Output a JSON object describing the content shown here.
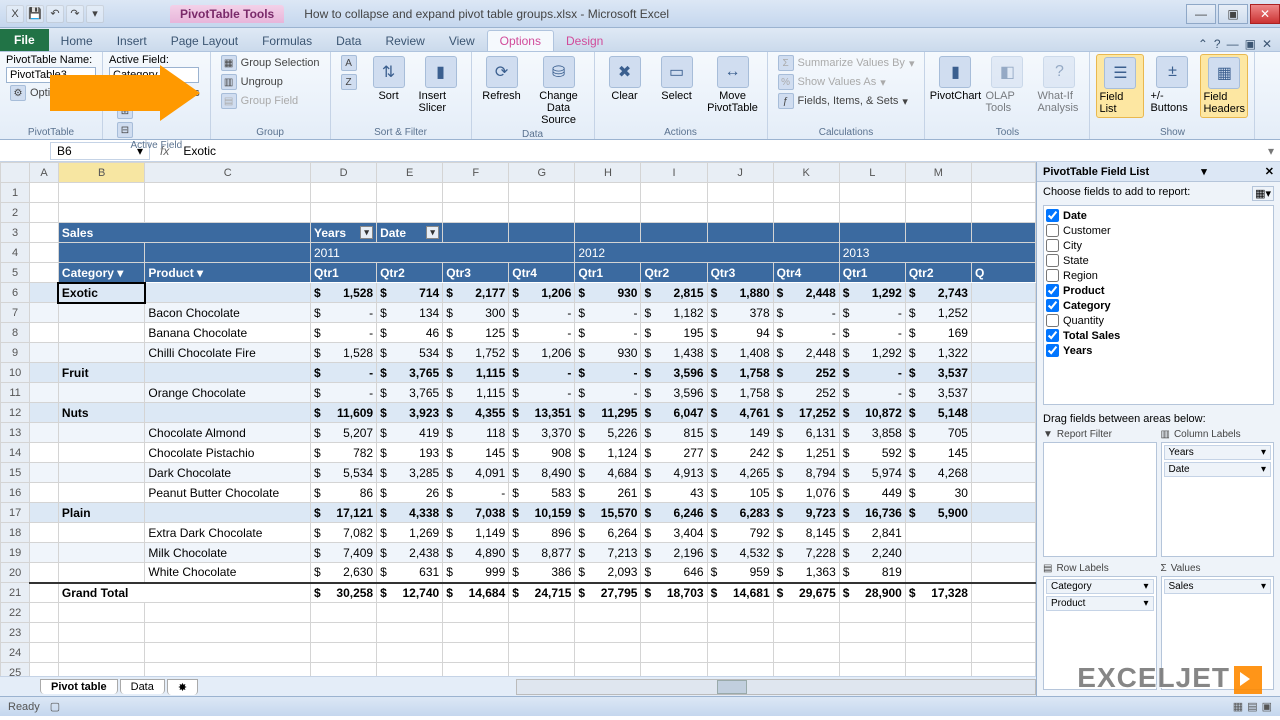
{
  "title": {
    "context_tab": "PivotTable Tools",
    "document": "How to collapse and expand pivot table groups.xlsx - Microsoft Excel"
  },
  "qat": [
    "excel-icon",
    "save",
    "undo",
    "redo"
  ],
  "tabs": [
    "File",
    "Home",
    "Insert",
    "Page Layout",
    "Formulas",
    "Data",
    "Review",
    "View",
    "Options",
    "Design"
  ],
  "active_tab": "Options",
  "ribbon": {
    "pt_name_label": "PivotTable Name:",
    "pt_name_value": "PivotTable3",
    "options_btn": "Options",
    "group1": "PivotTable",
    "active_field_label": "Active Field:",
    "active_field_value": "Category",
    "field_settings": "Field Settings",
    "group2": "Active Field",
    "group_selection": "Group Selection",
    "ungroup": "Ungroup",
    "group_field": "Group Field",
    "group3": "Group",
    "sort_az": "A→Z",
    "sort_za": "Z→A",
    "sort": "Sort",
    "insert_slicer": "Insert Slicer",
    "group4": "Sort & Filter",
    "refresh": "Refresh",
    "change_source": "Change Data Source",
    "group5": "Data",
    "clear": "Clear",
    "select": "Select",
    "move": "Move PivotTable",
    "group6": "Actions",
    "summarize": "Summarize Values By",
    "show_as": "Show Values As",
    "fields_items": "Fields, Items, & Sets",
    "group7": "Calculations",
    "pivotchart": "PivotChart",
    "olap": "OLAP Tools",
    "whatif": "What-If Analysis",
    "group8": "Tools",
    "field_list": "Field List",
    "pm_buttons": "+/- Buttons",
    "field_headers": "Field Headers",
    "group9": "Show"
  },
  "namebox": "B6",
  "fx_value": "Exotic",
  "col_letters": [
    "A",
    "B",
    "C",
    "D",
    "E",
    "F",
    "G",
    "H",
    "I",
    "J",
    "K",
    "L",
    "M"
  ],
  "pivot": {
    "title": "Sales",
    "years_label": "Years",
    "date_label": "Date",
    "years": [
      "2011",
      "2012",
      "2013"
    ],
    "category_label": "Category",
    "product_label": "Product",
    "quarters": [
      "Qtr1",
      "Qtr2",
      "Qtr3",
      "Qtr4",
      "Qtr1",
      "Qtr2",
      "Qtr3",
      "Qtr4",
      "Qtr1",
      "Qtr2",
      "Q"
    ],
    "rows": [
      {
        "type": "cat",
        "cat": "Exotic",
        "prod": "",
        "vals": [
          "1,528",
          "714",
          "2,177",
          "1,206",
          "930",
          "2,815",
          "1,880",
          "2,448",
          "1,292",
          "2,743"
        ]
      },
      {
        "type": "item",
        "prod": "Bacon Chocolate",
        "vals": [
          "-",
          "134",
          "300",
          "-",
          "-",
          "1,182",
          "378",
          "-",
          "-",
          "1,252"
        ]
      },
      {
        "type": "item",
        "prod": "Banana Chocolate",
        "vals": [
          "-",
          "46",
          "125",
          "-",
          "-",
          "195",
          "94",
          "-",
          "-",
          "169"
        ]
      },
      {
        "type": "item",
        "prod": "Chilli Chocolate Fire",
        "vals": [
          "1,528",
          "534",
          "1,752",
          "1,206",
          "930",
          "1,438",
          "1,408",
          "2,448",
          "1,292",
          "1,322"
        ]
      },
      {
        "type": "cat",
        "cat": "Fruit",
        "prod": "",
        "vals": [
          "-",
          "3,765",
          "1,115",
          "-",
          "-",
          "3,596",
          "1,758",
          "252",
          "-",
          "3,537"
        ]
      },
      {
        "type": "item",
        "prod": "Orange Chocolate",
        "vals": [
          "-",
          "3,765",
          "1,115",
          "-",
          "-",
          "3,596",
          "1,758",
          "252",
          "-",
          "3,537"
        ]
      },
      {
        "type": "cat",
        "cat": "Nuts",
        "prod": "",
        "vals": [
          "11,609",
          "3,923",
          "4,355",
          "13,351",
          "11,295",
          "6,047",
          "4,761",
          "17,252",
          "10,872",
          "5,148"
        ]
      },
      {
        "type": "item",
        "prod": "Chocolate Almond",
        "vals": [
          "5,207",
          "419",
          "118",
          "3,370",
          "5,226",
          "815",
          "149",
          "6,131",
          "3,858",
          "705"
        ]
      },
      {
        "type": "item",
        "prod": "Chocolate Pistachio",
        "vals": [
          "782",
          "193",
          "145",
          "908",
          "1,124",
          "277",
          "242",
          "1,251",
          "592",
          "145"
        ]
      },
      {
        "type": "item",
        "prod": "Dark Chocolate",
        "vals": [
          "5,534",
          "3,285",
          "4,091",
          "8,490",
          "4,684",
          "4,913",
          "4,265",
          "8,794",
          "5,974",
          "4,268"
        ]
      },
      {
        "type": "item",
        "prod": "Peanut Butter Chocolate",
        "vals": [
          "86",
          "26",
          "-",
          "583",
          "261",
          "43",
          "105",
          "1,076",
          "449",
          "30"
        ]
      },
      {
        "type": "cat",
        "cat": "Plain",
        "prod": "",
        "vals": [
          "17,121",
          "4,338",
          "7,038",
          "10,159",
          "15,570",
          "6,246",
          "6,283",
          "9,723",
          "16,736",
          "5,900"
        ]
      },
      {
        "type": "item",
        "prod": "Extra Dark Chocolate",
        "vals": [
          "7,082",
          "1,269",
          "1,149",
          "896",
          "6,264",
          "3,404",
          "792",
          "8,145",
          "2,841",
          ""
        ]
      },
      {
        "type": "item",
        "prod": "Milk Chocolate",
        "vals": [
          "7,409",
          "2,438",
          "4,890",
          "8,877",
          "7,213",
          "2,196",
          "4,532",
          "7,228",
          "2,240",
          ""
        ]
      },
      {
        "type": "item",
        "prod": "White Chocolate",
        "vals": [
          "2,630",
          "631",
          "999",
          "386",
          "2,093",
          "646",
          "959",
          "1,363",
          "819",
          ""
        ]
      },
      {
        "type": "gt",
        "cat": "Grand Total",
        "vals": [
          "30,258",
          "12,740",
          "14,684",
          "24,715",
          "27,795",
          "18,703",
          "14,681",
          "29,675",
          "28,900",
          "17,328"
        ]
      }
    ]
  },
  "sheet_tabs": [
    "Pivot table",
    "Data"
  ],
  "active_sheet": "Pivot table",
  "status": "Ready",
  "field_pane": {
    "title": "PivotTable Field List",
    "choose": "Choose fields to add to report:",
    "fields": [
      {
        "name": "Date",
        "checked": true
      },
      {
        "name": "Customer",
        "checked": false
      },
      {
        "name": "City",
        "checked": false
      },
      {
        "name": "State",
        "checked": false
      },
      {
        "name": "Region",
        "checked": false
      },
      {
        "name": "Product",
        "checked": true
      },
      {
        "name": "Category",
        "checked": true
      },
      {
        "name": "Quantity",
        "checked": false
      },
      {
        "name": "Total Sales",
        "checked": true
      },
      {
        "name": "Years",
        "checked": true
      }
    ],
    "drag_label": "Drag fields between areas below:",
    "areas": {
      "report_filter": {
        "label": "Report Filter",
        "items": []
      },
      "column_labels": {
        "label": "Column Labels",
        "items": [
          "Years",
          "Date"
        ]
      },
      "row_labels": {
        "label": "Row Labels",
        "items": [
          "Category",
          "Product"
        ]
      },
      "values": {
        "label": "Values",
        "items": [
          "Sales"
        ]
      }
    }
  },
  "logo": "EXCELJET"
}
